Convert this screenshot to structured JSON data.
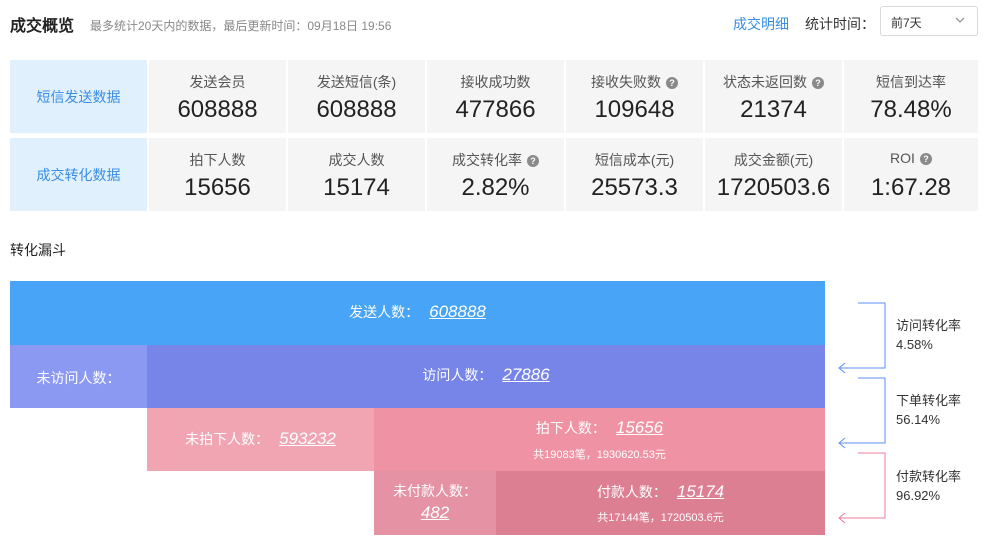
{
  "header": {
    "title": "成交概览",
    "subtitle": "最多统计20天内的数据，最后更新时间：09月18日 19:56",
    "detail_link": "成交明细",
    "stat_time_label": "统计时间：",
    "period_selected": "前7天"
  },
  "sms_row": {
    "head": "短信发送数据",
    "cells": [
      {
        "label": "发送会员",
        "value": "608888"
      },
      {
        "label": "发送短信(条)",
        "value": "608888"
      },
      {
        "label": "接收成功数",
        "value": "477866"
      },
      {
        "label": "接收失败数",
        "value": "109648",
        "help": "?"
      },
      {
        "label": "状态未返回数",
        "value": "21374",
        "help": "?"
      },
      {
        "label": "短信到达率",
        "value": "78.48%"
      }
    ]
  },
  "conv_row": {
    "head": "成交转化数据",
    "cells": [
      {
        "label": "拍下人数",
        "value": "15656"
      },
      {
        "label": "成交人数",
        "value": "15174"
      },
      {
        "label": "成交转化率",
        "value": "2.82%",
        "help": "?"
      },
      {
        "label": "短信成本(元)",
        "value": "25573.3"
      },
      {
        "label": "成交金额(元)",
        "value": "1720503.6"
      },
      {
        "label": "ROI",
        "value": "1:67.28",
        "help": "?"
      }
    ]
  },
  "funnel": {
    "title": "转化漏斗",
    "sent": {
      "label": "发送人数：",
      "value": "608888"
    },
    "not_visited": {
      "label": "未访问人数："
    },
    "visited": {
      "label": "访问人数：",
      "value": "27886"
    },
    "not_ordered": {
      "label": "未拍下人数：",
      "value": "593232"
    },
    "ordered": {
      "label": "拍下人数：",
      "value": "15656",
      "sub": "共19083笔，1930620.53元"
    },
    "not_paid": {
      "label": "未付款人数：",
      "value": "482"
    },
    "paid": {
      "label": "付款人数：",
      "value": "15174",
      "sub": "共17144笔，1720503.6元"
    },
    "rates": [
      {
        "name": "访问转化率",
        "value": "4.58%"
      },
      {
        "name": "下单转化率",
        "value": "56.14%"
      },
      {
        "name": "付款转化率",
        "value": "96.92%"
      }
    ]
  },
  "colors": {
    "accent": "#3a8ee6",
    "sent_bar": "#48a4f7",
    "visited_bar": "#7784e8",
    "not_visited_bar": "#8c99f2",
    "ordered_bar": "#ef93a4",
    "not_ordered_bar": "#f1a5b3",
    "paid_bar": "#dd7f93",
    "not_paid_bar": "#e592a5"
  }
}
